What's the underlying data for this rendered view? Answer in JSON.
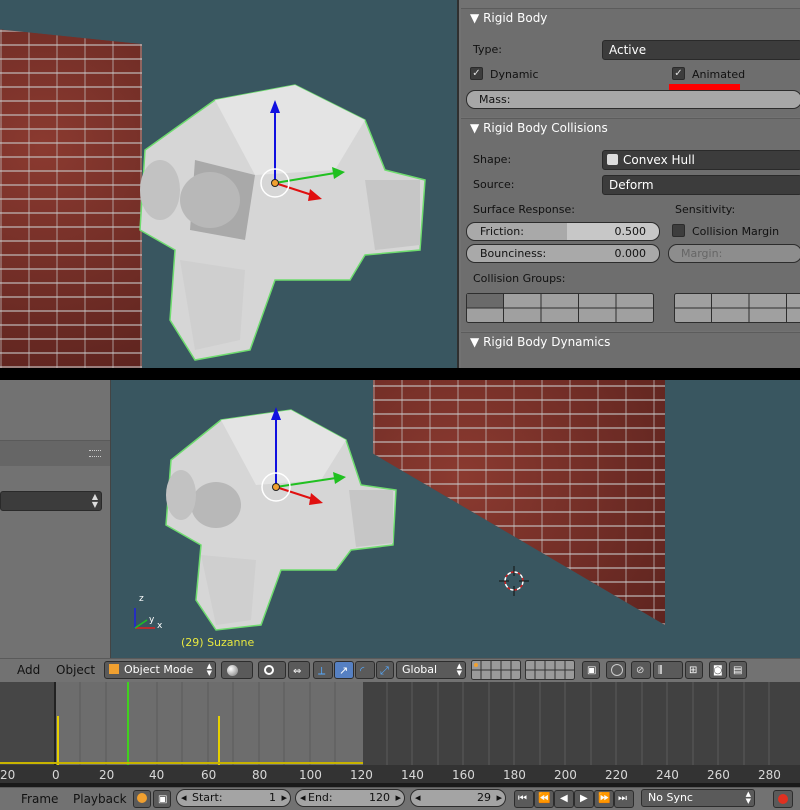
{
  "properties": {
    "rigid_body_header": "Rigid Body",
    "type_label": "Type:",
    "type_value": "Active",
    "dynamic_label": "Dynamic",
    "animated_label": "Animated",
    "mass_label": "Mass:",
    "collisions_header": "Rigid Body Collisions",
    "shape_label": "Shape:",
    "shape_value": "Convex Hull",
    "source_label": "Source:",
    "source_value": "Deform",
    "surface_response_label": "Surface Response:",
    "sensitivity_label": "Sensitivity:",
    "friction_label": "Friction:",
    "friction_value": "0.500",
    "friction_fraction": 0.5,
    "collision_margin_label": "Collision Margin",
    "bounciness_label": "Bounciness:",
    "bounciness_value": "0.000",
    "margin_label": "Margin:",
    "collision_groups_label": "Collision Groups:",
    "dynamics_header": "Rigid Body Dynamics",
    "highlight_color": "#ff0000"
  },
  "viewport": {
    "object_info": "(29) Suzanne",
    "axis_z": "z",
    "axis_x": "x",
    "axis_y": "y"
  },
  "header3d": {
    "add": "Add",
    "object": "Object",
    "mode": "Object Mode",
    "orientation": "Global"
  },
  "timeline": {
    "ticks": [
      "20",
      "0",
      "20",
      "40",
      "60",
      "80",
      "100",
      "120",
      "140",
      "160",
      "180",
      "200",
      "220",
      "240",
      "260",
      "280"
    ],
    "frame_menu": "Frame",
    "playback_menu": "Playback",
    "start_label": "Start:",
    "start_value": "1",
    "end_label": "End:",
    "end_value": "120",
    "current_frame": "29",
    "sync": "No Sync"
  },
  "colors": {
    "viewport_bg": "#395660",
    "panel_bg": "#727272",
    "keyframe_yellow": "#e6d000",
    "current_frame_green": "#40d020"
  }
}
